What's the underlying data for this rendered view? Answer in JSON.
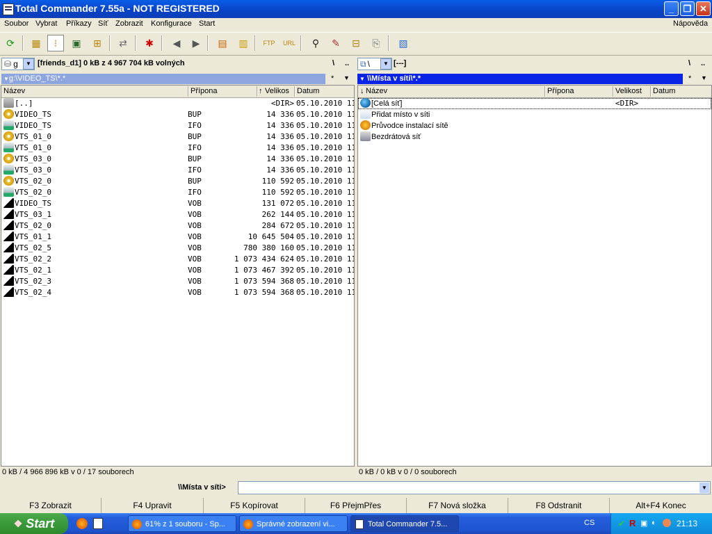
{
  "window": {
    "title": "Total Commander 7.55a - NOT REGISTERED"
  },
  "menu": {
    "items": [
      "Soubor",
      "Vybrat",
      "Příkazy",
      "Síť",
      "Zobrazit",
      "Konfigurace",
      "Start"
    ],
    "help": "Nápověda"
  },
  "toolbar": {
    "icons": [
      "refresh-icon",
      "brief-view-icon",
      "full-view-icon",
      "thumbnail-view-icon",
      "tree-view-icon",
      "compare-dirs-icon",
      "select-icon",
      "back-icon",
      "forward-icon",
      "pack-icon",
      "unpack-icon",
      "ftp-icon",
      "url-icon",
      "find-icon",
      "rename-icon",
      "sync-icon",
      "copy-names-icon",
      "notepad-icon"
    ]
  },
  "left": {
    "drive_letter": "g",
    "drive_info": "[friends_d1]  0 kB z 4 967 704 kB volných",
    "root": "\\",
    "up": "..",
    "path": "g:\\VIDEO_TS\\*.*",
    "filter": "*",
    "cols": {
      "name": "Název",
      "ext": "Přípona",
      "size": "Velikos",
      "date": "Datum"
    },
    "rows": [
      {
        "name": "[..]",
        "ext": "",
        "size": "<DIR>",
        "date": "05.10.2010 11",
        "icon": "up"
      },
      {
        "name": "VIDEO_TS",
        "ext": "BUP",
        "size": "14 336",
        "date": "05.10.2010 11",
        "icon": "bup"
      },
      {
        "name": "VIDEO_TS",
        "ext": "IFO",
        "size": "14 336",
        "date": "05.10.2010 11",
        "icon": "ifo"
      },
      {
        "name": "VTS_01_0",
        "ext": "BUP",
        "size": "14 336",
        "date": "05.10.2010 11",
        "icon": "bup"
      },
      {
        "name": "VTS_01_0",
        "ext": "IFO",
        "size": "14 336",
        "date": "05.10.2010 11",
        "icon": "ifo"
      },
      {
        "name": "VTS_03_0",
        "ext": "BUP",
        "size": "14 336",
        "date": "05.10.2010 11",
        "icon": "bup"
      },
      {
        "name": "VTS_03_0",
        "ext": "IFO",
        "size": "14 336",
        "date": "05.10.2010 11",
        "icon": "ifo"
      },
      {
        "name": "VTS_02_0",
        "ext": "BUP",
        "size": "110 592",
        "date": "05.10.2010 11",
        "icon": "bup"
      },
      {
        "name": "VTS_02_0",
        "ext": "IFO",
        "size": "110 592",
        "date": "05.10.2010 11",
        "icon": "ifo"
      },
      {
        "name": "VIDEO_TS",
        "ext": "VOB",
        "size": "131 072",
        "date": "05.10.2010 11",
        "icon": "vob"
      },
      {
        "name": "VTS_03_1",
        "ext": "VOB",
        "size": "262 144",
        "date": "05.10.2010 11",
        "icon": "vob"
      },
      {
        "name": "VTS_02_0",
        "ext": "VOB",
        "size": "284 672",
        "date": "05.10.2010 11",
        "icon": "vob"
      },
      {
        "name": "VTS_01_1",
        "ext": "VOB",
        "size": "10 645 504",
        "date": "05.10.2010 11",
        "icon": "vob"
      },
      {
        "name": "VTS_02_5",
        "ext": "VOB",
        "size": "780 380 160",
        "date": "05.10.2010 11",
        "icon": "vob"
      },
      {
        "name": "VTS_02_2",
        "ext": "VOB",
        "size": "1 073 434 624",
        "date": "05.10.2010 11",
        "icon": "vob"
      },
      {
        "name": "VTS_02_1",
        "ext": "VOB",
        "size": "1 073 467 392",
        "date": "05.10.2010 11",
        "icon": "vob"
      },
      {
        "name": "VTS_02_3",
        "ext": "VOB",
        "size": "1 073 594 368",
        "date": "05.10.2010 11",
        "icon": "vob"
      },
      {
        "name": "VTS_02_4",
        "ext": "VOB",
        "size": "1 073 594 368",
        "date": "05.10.2010 11",
        "icon": "vob"
      }
    ],
    "status": "0 kB / 4 966 896 kB v 0 / 17 souborech"
  },
  "right": {
    "drive_letter": "\\",
    "drive_info": "[---]",
    "root": "\\",
    "up": "..",
    "path": "\\\\Místa v síti\\*.*",
    "filter": "*",
    "cols": {
      "name": "Název",
      "ext": "Přípona",
      "size": "Velikost",
      "date": "Datum"
    },
    "rows": [
      {
        "name": "[Celá síť]",
        "ext": "",
        "size": "<DIR>",
        "date": "",
        "icon": "globe"
      },
      {
        "name": "Přidat místo v síti",
        "ext": "",
        "size": "",
        "date": "",
        "icon": "add"
      },
      {
        "name": "Průvodce instalací sítě",
        "ext": "",
        "size": "",
        "date": "",
        "icon": "wizard"
      },
      {
        "name": "Bezdrátová síť",
        "ext": "",
        "size": "",
        "date": "",
        "icon": "wireless"
      }
    ],
    "status": "0 kB / 0 kB v 0 / 0 souborech"
  },
  "cmdline": {
    "label": "\\\\Místa v síti>",
    "value": ""
  },
  "fkeys": [
    "F3 Zobrazit",
    "F4 Upravit",
    "F5 Kopírovat",
    "F6 PřejmPřes",
    "F7 Nová složka",
    "F8 Odstranit",
    "Alt+F4 Konec"
  ],
  "taskbar": {
    "start": "Start",
    "tasks": [
      "61% z 1 souboru - Sp...",
      "Správné zobrazení vi...",
      "Total Commander 7.5..."
    ],
    "lang": "CS",
    "clock": "21:13"
  },
  "colors": {
    "active_path": "#0a24e6",
    "inactive_path": "#8ea6e0",
    "titlebar": "#0842c4"
  }
}
